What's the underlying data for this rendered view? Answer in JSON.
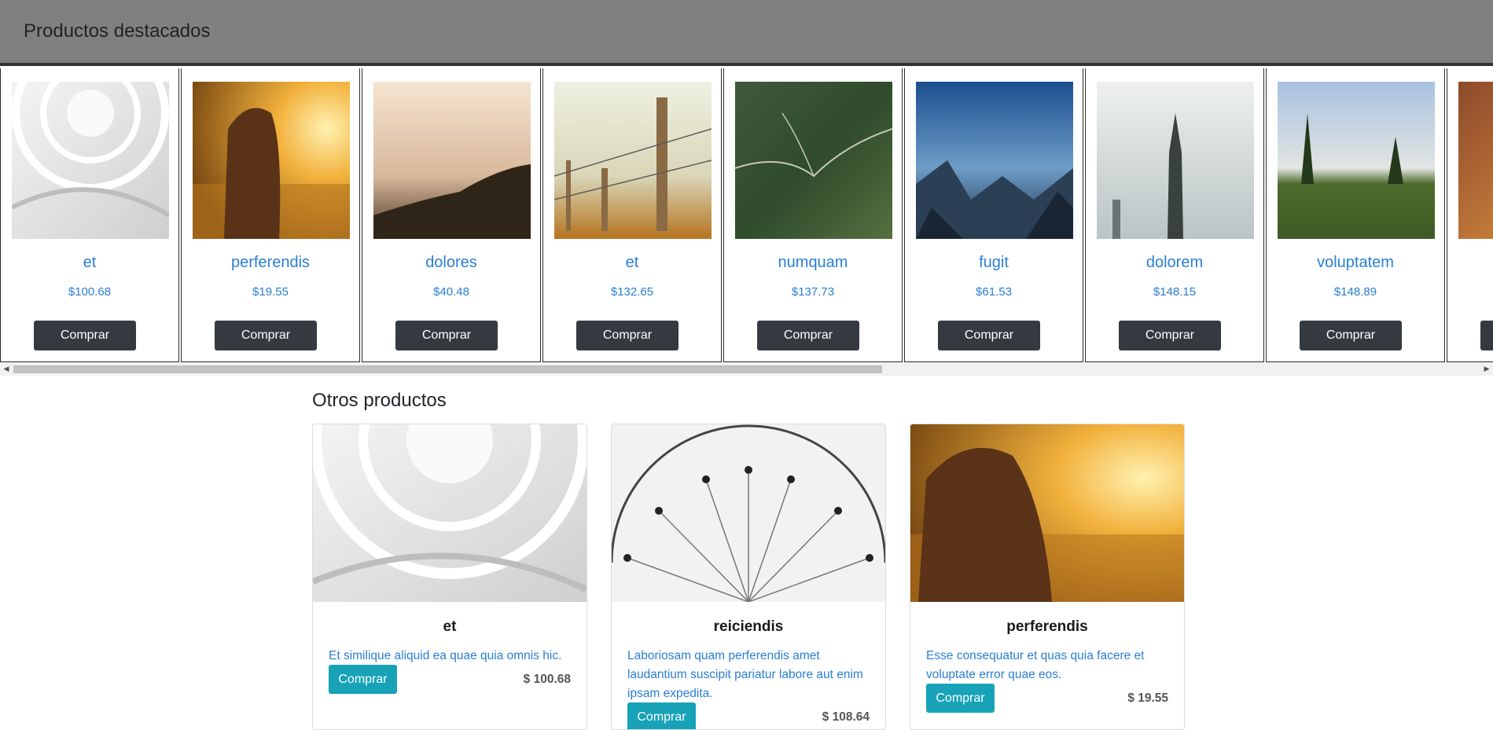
{
  "header": {
    "title": "Productos destacados"
  },
  "featured": [
    {
      "name": "et",
      "price": "$100.68",
      "button": "Comprar",
      "image": "white spiral atrium interior"
    },
    {
      "name": "perferendis",
      "price": "$19.55",
      "button": "Comprar",
      "image": "girl in golden field at sunset"
    },
    {
      "name": "dolores",
      "price": "$40.48",
      "button": "Comprar",
      "image": "misty hills at dawn"
    },
    {
      "name": "et",
      "price": "$132.65",
      "button": "Comprar",
      "image": "wooden fence with barbed wire"
    },
    {
      "name": "numquam",
      "price": "$137.73",
      "button": "Comprar",
      "image": "aerial view of green mountains"
    },
    {
      "name": "fugit",
      "price": "$61.53",
      "button": "Comprar",
      "image": "mountain valley under blue sky"
    },
    {
      "name": "dolorem",
      "price": "$148.15",
      "button": "Comprar",
      "image": "city tower double exposure"
    },
    {
      "name": "voluptatem",
      "price": "$148.89",
      "button": "Comprar",
      "image": "green meadow with trees"
    },
    {
      "name": "",
      "price": "",
      "button": "",
      "image": "partially visible warm sunset"
    }
  ],
  "others": {
    "title": "Otros productos",
    "items": [
      {
        "name": "et",
        "desc": "Et similique aliquid ea quae quia omnis hic.",
        "button": "Comprar",
        "price": "$ 100.68",
        "image": "white spiral atrium interior"
      },
      {
        "name": "reiciendis",
        "desc": "Laboriosam quam perferendis amet laudantium suscipit pariatur labore aut enim ipsam expedita.",
        "button": "Comprar",
        "price": "$ 108.64",
        "image": "ferris wheel black and white"
      },
      {
        "name": "perferendis",
        "desc": "Esse consequatur et quas quia facere et voluptate error quae eos.",
        "button": "Comprar",
        "price": "$ 19.55",
        "image": "girl in golden field at sunset"
      }
    ]
  },
  "colors": {
    "header_bg": "#808080",
    "link_blue": "#2a7fd4",
    "dark_button": "#343a40",
    "teal_button": "#17a2b8"
  }
}
